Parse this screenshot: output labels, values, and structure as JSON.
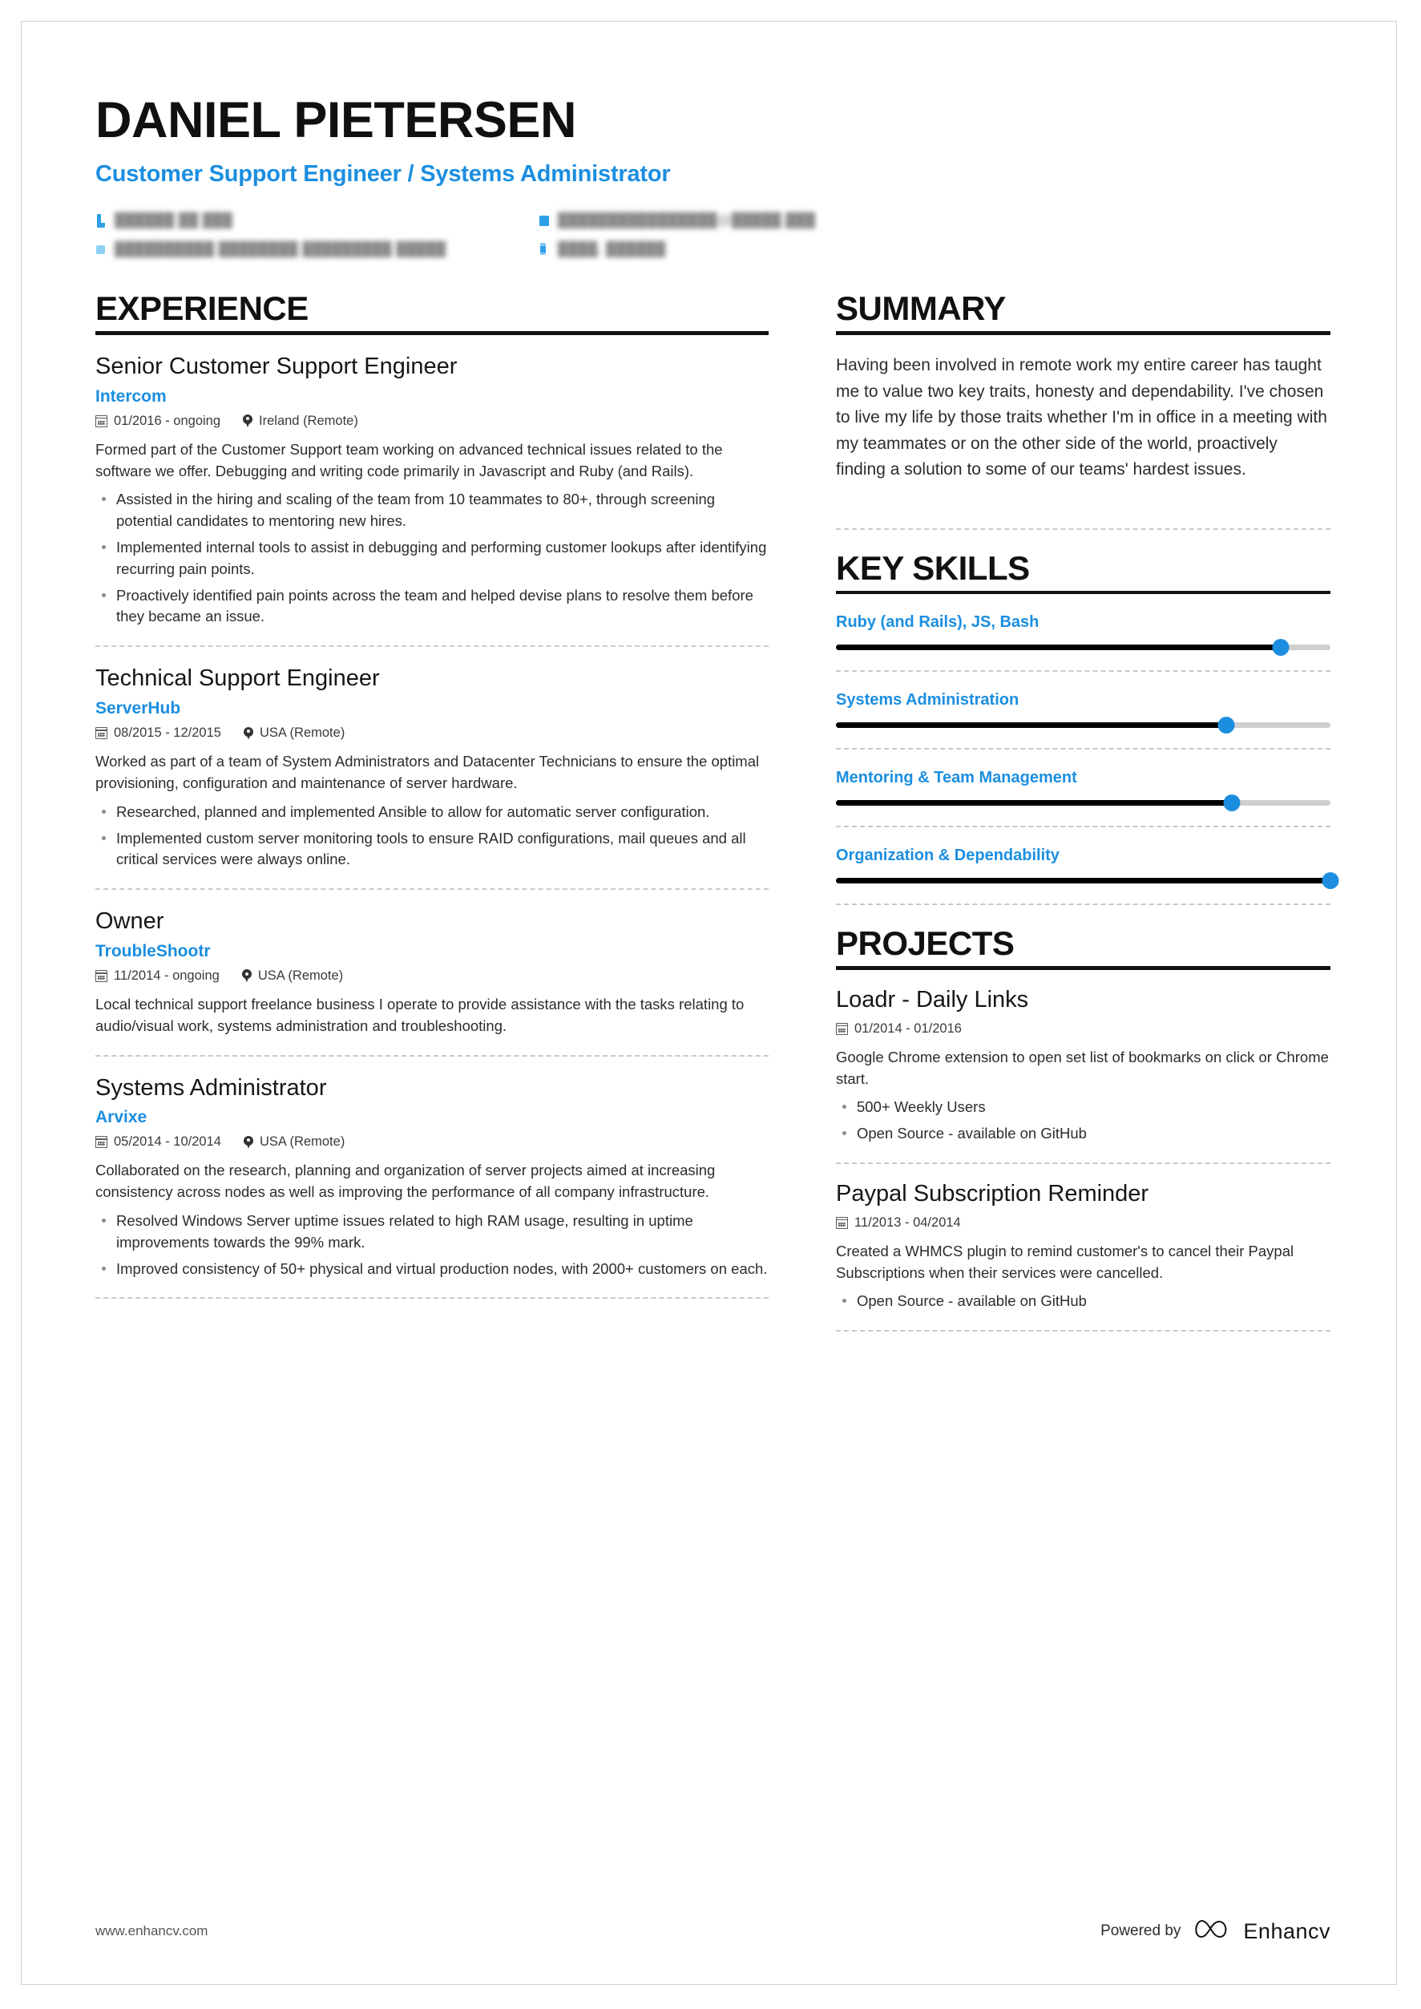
{
  "header": {
    "name": "DANIEL PIETERSEN",
    "headline": "Customer Support Engineer / Systems Administrator",
    "contacts": [
      {
        "icon": "phone-icon",
        "value": "██████ ██ ███",
        "redacted": true
      },
      {
        "icon": "mail-icon",
        "value": "████████████████@█████.███",
        "redacted": true
      },
      {
        "icon": "link-icon",
        "value": "██████████ ████████ █████████ █████",
        "redacted": true
      },
      {
        "icon": "location-pin-icon",
        "value": "████, ██████",
        "redacted": true
      }
    ]
  },
  "experience": {
    "section_title": "EXPERIENCE",
    "entries": [
      {
        "title": "Senior Customer Support Engineer",
        "organization": "Intercom",
        "date": "01/2016 - ongoing",
        "location": "Ireland (Remote)",
        "description": "Formed part of the Customer Support team working on advanced technical issues related to the software we offer. Debugging and writing code primarily in Javascript and Ruby (and Rails).",
        "bullets": [
          "Assisted in the hiring and scaling of the team from 10 teammates to 80+, through screening potential candidates to mentoring new hires.",
          "Implemented internal tools to assist in debugging and performing customer lookups after identifying recurring pain points.",
          "Proactively identified pain points across the team and helped devise plans to resolve them before they became an issue."
        ]
      },
      {
        "title": "Technical Support Engineer",
        "organization": "ServerHub",
        "date": "08/2015 - 12/2015",
        "location": "USA (Remote)",
        "description": "Worked as part of a team of System Administrators and Datacenter Technicians to ensure the optimal provisioning, configuration and maintenance of server hardware.",
        "bullets": [
          "Researched, planned and implemented Ansible to allow for automatic server configuration.",
          "Implemented custom server monitoring tools to ensure RAID configurations, mail queues and all critical services were always online."
        ]
      },
      {
        "title": "Owner",
        "organization": "TroubleShootr",
        "date": "11/2014 - ongoing",
        "location": "USA (Remote)",
        "description": "Local technical support freelance business I operate to provide assistance with the tasks relating to audio/visual work, systems administration and troubleshooting.",
        "bullets": []
      },
      {
        "title": "Systems Administrator",
        "organization": "Arvixe",
        "date": "05/2014 - 10/2014",
        "location": "USA (Remote)",
        "description": "Collaborated on the research, planning and organization of server projects aimed at increasing consistency across nodes as well as improving the performance of all company infrastructure.",
        "bullets": [
          "Resolved Windows Server uptime issues related to high RAM usage, resulting in uptime improvements towards the 99% mark.",
          "Improved consistency of 50+ physical and virtual production nodes, with 2000+ customers on each."
        ]
      }
    ]
  },
  "summary": {
    "section_title": "SUMMARY",
    "text": "Having been involved in remote work my entire career has taught me to value two key traits, honesty and dependability. I've chosen to live my life by those traits whether I'm in office in a meeting with my teammates or on the other side of the world, proactively finding a solution to some of our teams' hardest issues."
  },
  "key_skills": {
    "section_title": "KEY SKILLS",
    "items": [
      {
        "label": "Ruby (and Rails), JS, Bash",
        "value": 90
      },
      {
        "label": "Systems Administration",
        "value": 79
      },
      {
        "label": "Mentoring & Team Management",
        "value": 80
      },
      {
        "label": "Organization & Dependability",
        "value": 100
      }
    ]
  },
  "projects": {
    "section_title": "PROJECTS",
    "entries": [
      {
        "title": "Loadr - Daily Links",
        "date": "01/2014 - 01/2016",
        "description": "Google Chrome extension to open set list of bookmarks on click or Chrome start.",
        "bullets": [
          "500+ Weekly Users",
          "Open Source - available on GitHub"
        ]
      },
      {
        "title": "Paypal Subscription Reminder",
        "date": "11/2013 - 04/2014",
        "description": "Created a WHMCS plugin to remind customer's to cancel their Paypal Subscriptions when their services were cancelled.",
        "bullets": [
          "Open Source - available on GitHub"
        ]
      }
    ]
  },
  "footer": {
    "website": "www.enhancv.com",
    "powered_by_label": "Powered by",
    "brand": "Enhancv"
  },
  "colors": {
    "accent_blue": "#1b8ee0",
    "text_dark": "#2c2c2c",
    "rule_black": "#111111",
    "slider_track": "#cfcfcf"
  }
}
